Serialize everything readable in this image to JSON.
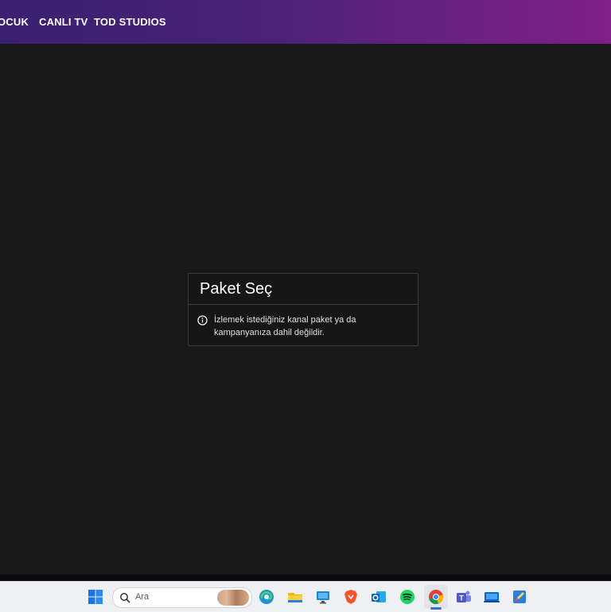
{
  "nav": {
    "items": [
      {
        "label": "OCUK"
      },
      {
        "label": "CANLI TV"
      },
      {
        "label": "TOD STUDIOS"
      }
    ]
  },
  "modal": {
    "title": "Paket Seç",
    "message": "İzlemek istediğiniz kanal paket ya da kampanyanıza dahil değildir.",
    "icon": "info-icon"
  },
  "taskbar": {
    "search_placeholder": "Ara",
    "icons": [
      "windows-start-icon",
      "search-icon",
      "edge-icon",
      "file-explorer-icon",
      "remote-desktop-icon",
      "brave-icon",
      "outlook-icon",
      "spotify-icon",
      "chrome-icon",
      "teams-icon",
      "quick-assist-icon",
      "paint-icon"
    ]
  },
  "colors": {
    "header_gradient_start": "#3a2070",
    "header_gradient_end": "#7e2086",
    "page_background": "#191919",
    "modal_border": "#3a3a3a"
  }
}
